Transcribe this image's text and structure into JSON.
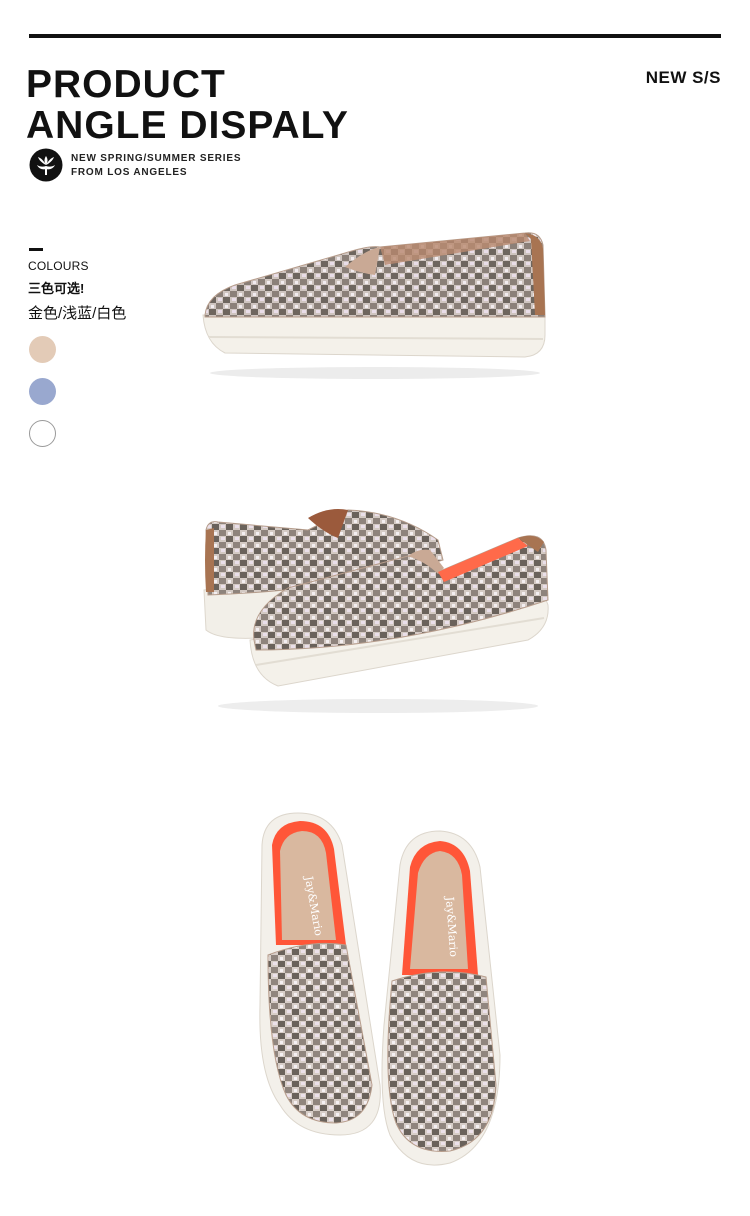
{
  "header": {
    "title_line1": "PRODUCT",
    "title_line2": "ANGLE DISPALY",
    "season": "NEW S/S",
    "tagline_line1": "NEW SPRING/SUMMER SERIES",
    "tagline_line2": "FROM LOS ANGELES",
    "logo_icon": "lotus-logo-icon"
  },
  "colours": {
    "label": "COLOURS",
    "heading": "三色可选!",
    "list": "金色/浅蓝/白色",
    "swatches": [
      {
        "name": "金色",
        "color": "#e3cbb7"
      },
      {
        "name": "浅蓝",
        "color": "#99a8cf"
      },
      {
        "name": "白色",
        "color": "#ffffff"
      }
    ]
  },
  "insole": {
    "brand": "Jay&Mario"
  }
}
